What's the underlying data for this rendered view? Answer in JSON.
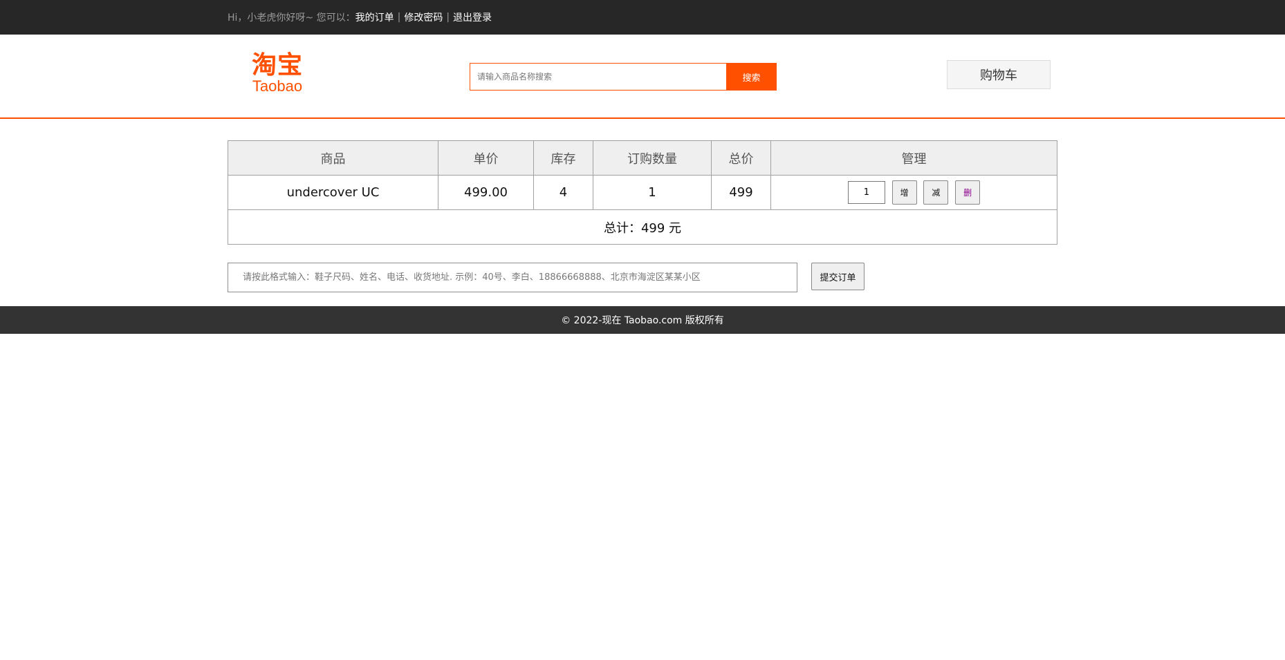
{
  "topbar": {
    "greeting": "Hi，小老虎你好呀~ 您可以：",
    "links": [
      "我的订单",
      "修改密码",
      "退出登录"
    ],
    "separator": "|"
  },
  "header": {
    "logo_cn": "淘宝",
    "logo_en": "Taobao",
    "search_placeholder": "请输入商品名称搜索",
    "search_button": "搜索",
    "cart_button": "购物车"
  },
  "cart": {
    "columns": [
      "商品",
      "单价",
      "库存",
      "订购数量",
      "总价",
      "管理"
    ],
    "rows": [
      {
        "name": "undercover UC",
        "price": "499.00",
        "stock": "4",
        "quantity": "1",
        "total": "499",
        "qty_input": "1",
        "add_label": "增",
        "minus_label": "减",
        "delete_label": "删"
      }
    ],
    "summary": "总计：499 元"
  },
  "order": {
    "address_placeholder": "请按此格式输入：鞋子尺码、姓名、电话、收货地址. 示例：40号、李白、18866668888、北京市海淀区某某小区",
    "submit_button": "提交订单"
  },
  "footer": {
    "copyright": "© 2022-现在 Taobao.com 版权所有"
  },
  "colors": {
    "brand": "#ff5000",
    "topbar_bg": "#272727",
    "footer_bg": "#333333"
  }
}
